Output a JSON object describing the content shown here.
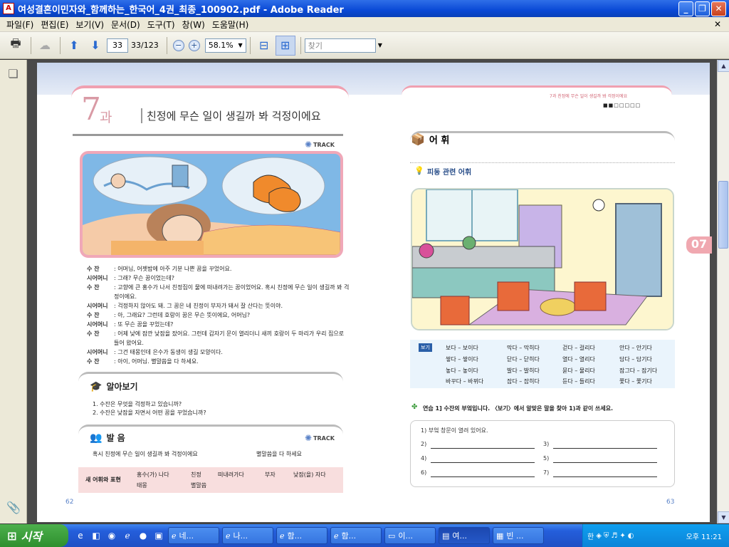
{
  "window": {
    "title": "여성결혼이민자와_함께하는_한국어_4권_최종_100902.pdf - Adobe Reader"
  },
  "menu": [
    "파일(F)",
    "편집(E)",
    "보기(V)",
    "문서(D)",
    "도구(T)",
    "창(W)",
    "도움말(H)"
  ],
  "toolbar": {
    "page_value": "33",
    "page_total": "33/123",
    "zoom_value": "58.1%",
    "search_placeholder": "찾기"
  },
  "left_page": {
    "lesson_number": "7",
    "lesson_word": "과",
    "title": "친정에 무슨 일이 생길까 봐 걱정이에요",
    "track_label": "TRACK",
    "dialogue": [
      {
        "speaker": "수  잔",
        "text": ": 어머님, 어젯밤에 아주 기분 나쁜 꿈을 꾸었어요."
      },
      {
        "speaker": "시어머니",
        "text": ": 그래? 무슨 꿈이었는데?"
      },
      {
        "speaker": "수  잔",
        "text": ": 고향에 큰 홍수가 나서 친정집이 물에 떠내려가는 꿈이었어요. 혹시 친정에 무슨 일이 생길까 봐 걱정이에요."
      },
      {
        "speaker": "시어머니",
        "text": ": 걱정하지 않아도 돼. 그 꿈은 네 친정이 부자가 돼서 잘 산다는 뜻이야."
      },
      {
        "speaker": "수  잔",
        "text": ": 아, 그래요? 그런데 호랑이 꿈은 무슨 뜻이에요, 어머님?"
      },
      {
        "speaker": "시어머니",
        "text": ": 또 무슨 꿈을 꾸었는데?"
      },
      {
        "speaker": "수  잔",
        "text": ": 어제 낮에 잠깐 낮잠을 잤어요. 그런데 갑자기 문이 열리더니 새끼 호랑이 두 마리가 우리 집으로 들어 왔어요."
      },
      {
        "speaker": "시어머니",
        "text": ": 그건 태몽인데 은수가 동생이 생길 모양이다."
      },
      {
        "speaker": "수  잔",
        "text": ": 아이, 어머님. 별말씀을 다 하세요."
      }
    ],
    "alabogi": {
      "title": "알아보기",
      "questions": [
        "1. 수잔은 무엇을 걱정하고 있습니까?",
        "2. 수잔은 낮잠을 자면서 어떤 꿈을 꾸었습니까?"
      ]
    },
    "pronunciation": {
      "title": "발 음",
      "track_label": "TRACK",
      "line1": "혹시 친정에 무슨 일이 생길까 봐 걱정이에요",
      "line2": "별말씀을 다 하세요"
    },
    "new_words": {
      "label": "새 어휘와 표현",
      "words": [
        "홍수(가) 나다",
        "친정",
        "떠내려가다",
        "부자",
        "낮잠(을) 자다",
        "태몽",
        "별말씀"
      ]
    },
    "page_number": "62"
  },
  "right_page": {
    "header_text": "7과 친정에 무슨 일이 생길까 봐 걱정이에요",
    "header_dots": "■■□□□□□",
    "vocab_title": "어 휘",
    "subhead": "피동 관련 어휘",
    "bogi_label": "보기",
    "bogi_words": [
      [
        "보다 – 보이다",
        "막다 – 막히다",
        "걷다 – 걸리다",
        "안다 – 안기다"
      ],
      [
        "쌓다 – 쌓이다",
        "닫다 – 닫히다",
        "열다 – 열리다",
        "담다 – 담기다"
      ],
      [
        "놓다 – 놓이다",
        "발다 – 발히다",
        "묻다 – 물리다",
        "잠그다 – 잠기다"
      ],
      [
        "바꾸다 – 바뀌다",
        "잡다 – 잡히다",
        "듣다 – 들리다",
        "쫓다 – 쫓기다"
      ]
    ],
    "exercise_label": "연습 1] 수잔의 부엌입니다. 〈보기〉에서 알맞은 말을 찾아 1)과 같이 쓰세요.",
    "answer_example": "1)  부엌 창문이 열려 있어요.",
    "answer_nums": [
      "2)",
      "3)",
      "4)",
      "5)",
      "6)",
      "7)"
    ],
    "side_tab": "07",
    "page_number": "63"
  },
  "taskbar": {
    "start_label": "시작",
    "tasks": [
      "네...",
      "나...",
      "함...",
      "함...",
      "이...",
      "여...",
      "빈 ..."
    ],
    "clock": "오후 11:21"
  }
}
